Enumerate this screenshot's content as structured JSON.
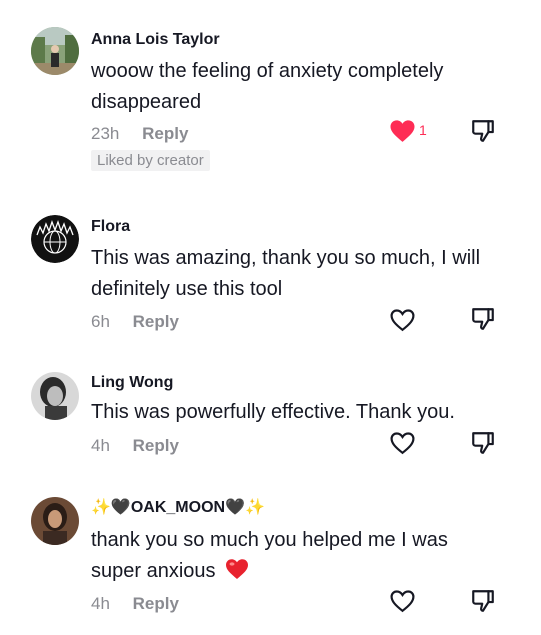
{
  "comments": [
    {
      "username": "Anna Lois Taylor",
      "text": "wooow the feeling of anxiety completely disappeared",
      "time": "23h",
      "reply_label": "Reply",
      "liked_badge": "Liked by creator",
      "like_count": "1",
      "liked": true
    },
    {
      "username": "Flora",
      "text": "This was amazing, thank you so much, I will definitely use this tool",
      "time": "6h",
      "reply_label": "Reply",
      "liked": false
    },
    {
      "username": "Ling Wong",
      "text": "This was powerfully effective. Thank you.",
      "time": "4h",
      "reply_label": "Reply",
      "liked": false
    },
    {
      "username": "✨🖤OAK_MOON🖤✨",
      "text": "thank you so much you helped me I was super anxious",
      "time": "4h",
      "reply_label": "Reply",
      "liked": false
    }
  ],
  "colors": {
    "accent": "#fe2c55",
    "muted": "#8a8b91",
    "text": "#161823"
  },
  "icons": {
    "like": "heart-outline-icon",
    "liked": "heart-filled-icon",
    "dislike": "thumbs-down-icon"
  }
}
